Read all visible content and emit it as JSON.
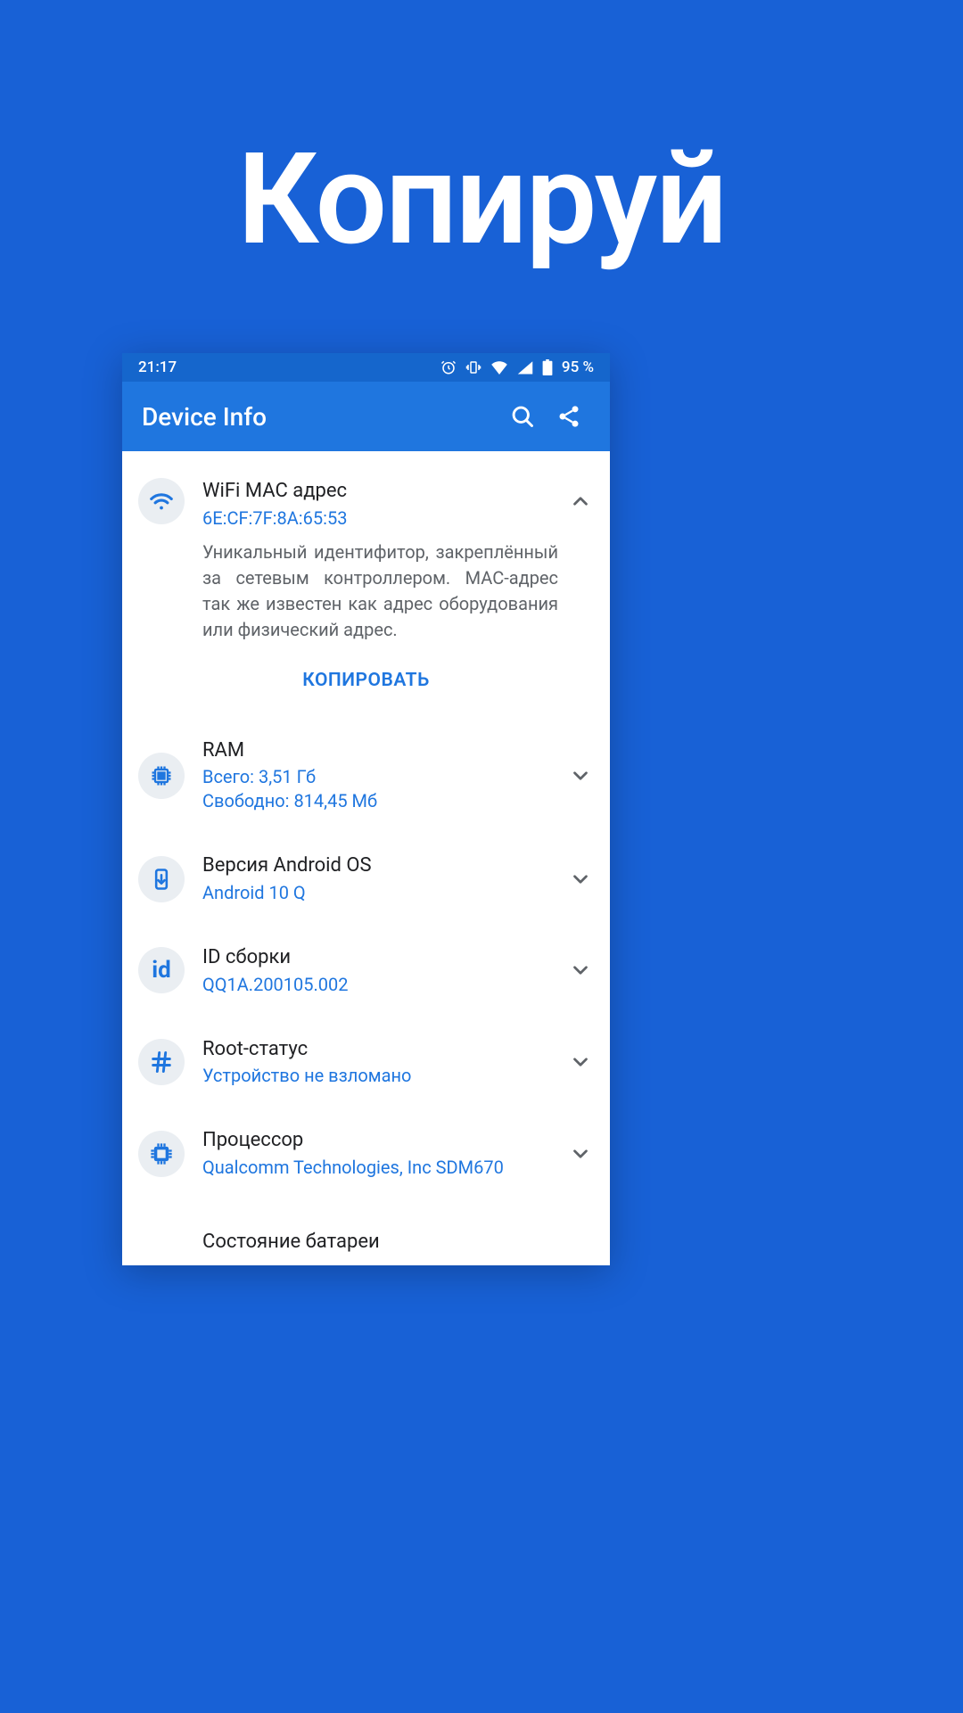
{
  "hero": "Копируй",
  "status": {
    "time": "21:17",
    "battery_text": "95 %"
  },
  "appbar": {
    "title": "Device Info"
  },
  "copy_button": "КОПИРОВАТЬ",
  "items": [
    {
      "icon": "wifi",
      "title": "WiFi MAC адрес",
      "value": "6E:CF:7F:8A:65:53",
      "desc": "Уникальный идентифитор, закреплённый за сетевым контроллером. MAC-адрес так же известен как адрес оборудования или физический адрес.",
      "expanded": true
    },
    {
      "icon": "chip",
      "title": "RAM",
      "value": "Всего: 3,51 Гб\nСвободно: 814,45 Мб",
      "expanded": false
    },
    {
      "icon": "android",
      "title": "Версия Android OS",
      "value": "Android 10 Q",
      "expanded": false
    },
    {
      "icon": "id",
      "title": "ID сборки",
      "value": "QQ1A.200105.002",
      "expanded": false
    },
    {
      "icon": "hash",
      "title": "Root-статус",
      "value": "Устройство не взломано",
      "expanded": false
    },
    {
      "icon": "cpu",
      "title": "Процессор",
      "value": "Qualcomm Technologies, Inc SDM670",
      "expanded": false
    },
    {
      "icon": "battery",
      "title": "Состояние батареи",
      "value": "",
      "expanded": false
    }
  ]
}
